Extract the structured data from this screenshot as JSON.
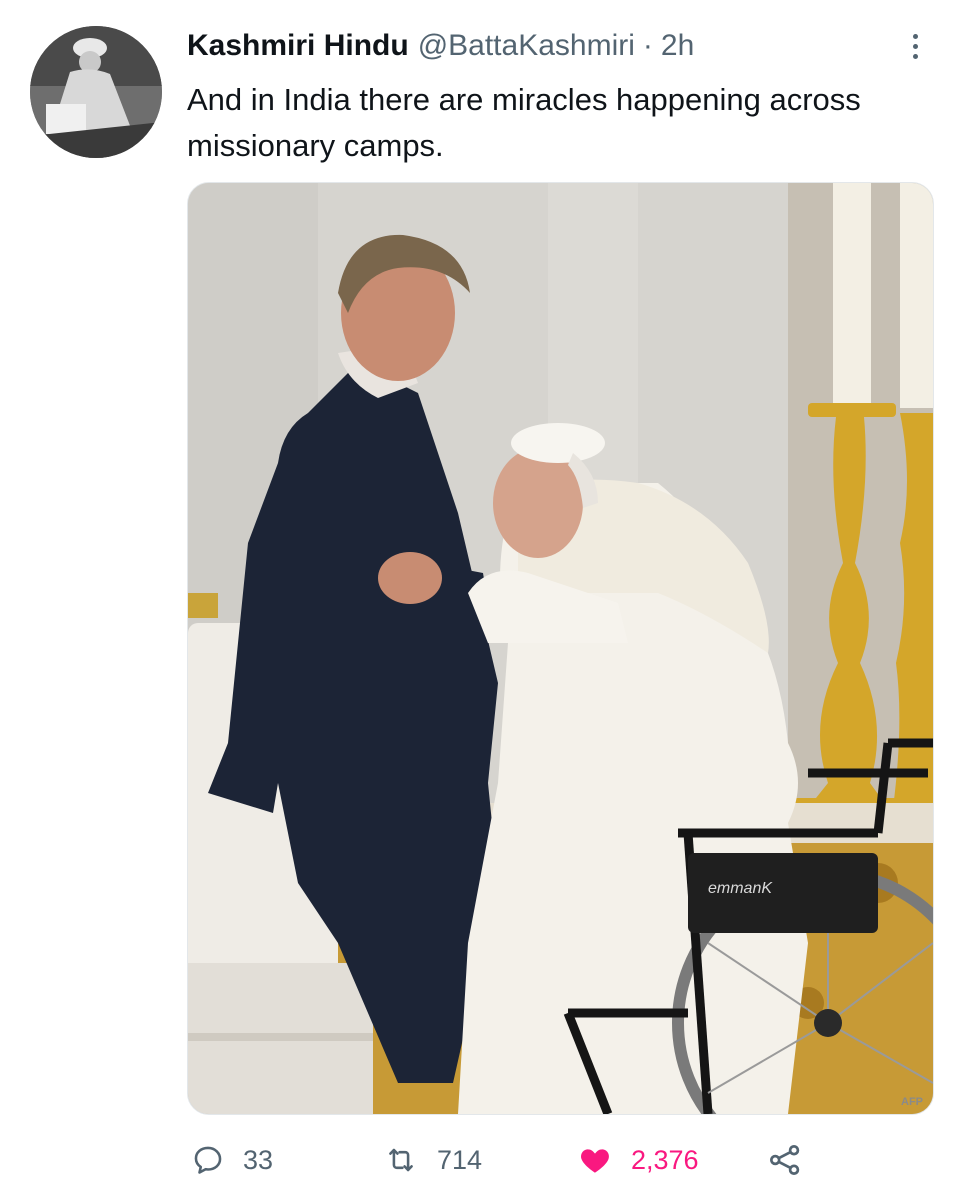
{
  "tweet": {
    "display_name": "Kashmiri Hindu",
    "handle": "@BattaKashmiri",
    "separator": "·",
    "time": "2h",
    "text": "And in India there are miracles happening across missionary camps.",
    "media": {
      "watermark": "AFP",
      "wheelchair_label": "emmanK"
    }
  },
  "actions": {
    "reply_count": "33",
    "retweet_count": "714",
    "like_count": "2,376",
    "liked": true
  },
  "colors": {
    "text_primary": "#0f1419",
    "text_secondary": "#536471",
    "like_active": "#f91880",
    "border": "#e3e7ea"
  },
  "icons": {
    "more": "more-dots-icon",
    "reply": "reply-bubble-icon",
    "retweet": "retweet-arrows-icon",
    "like": "heart-filled-icon",
    "share": "share-nodes-icon"
  }
}
